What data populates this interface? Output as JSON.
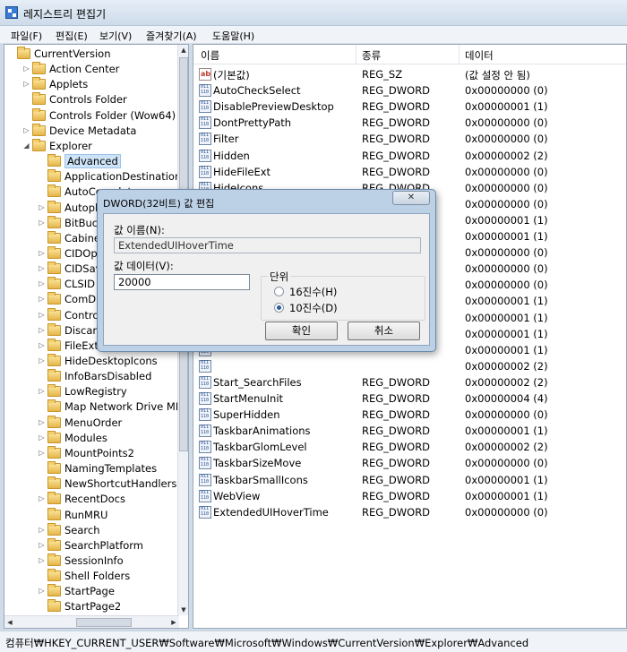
{
  "window": {
    "title": "레지스트리 편집기"
  },
  "menu": [
    "파일(F)",
    "편집(E)",
    "보기(V)",
    "즐겨찾기(A)",
    "도움말(H)"
  ],
  "tree": [
    {
      "label": "CurrentVersion",
      "level": 0,
      "expander": "",
      "selected": false
    },
    {
      "label": "Action Center",
      "level": 1,
      "expander": "▷",
      "selected": false
    },
    {
      "label": "Applets",
      "level": 1,
      "expander": "▷",
      "selected": false
    },
    {
      "label": "Controls Folder",
      "level": 1,
      "expander": "",
      "selected": false
    },
    {
      "label": "Controls Folder (Wow64)",
      "level": 1,
      "expander": "",
      "selected": false
    },
    {
      "label": "Device Metadata",
      "level": 1,
      "expander": "▷",
      "selected": false
    },
    {
      "label": "Explorer",
      "level": 1,
      "expander": "◢",
      "selected": false
    },
    {
      "label": "Advanced",
      "level": 2,
      "expander": "",
      "selected": true
    },
    {
      "label": "ApplicationDestinations",
      "level": 2,
      "expander": "",
      "selected": false
    },
    {
      "label": "AutoComplete",
      "level": 2,
      "expander": "",
      "selected": false
    },
    {
      "label": "Autoplay",
      "level": 2,
      "expander": "▷",
      "selected": false
    },
    {
      "label": "BitBucket",
      "level": 2,
      "expander": "▷",
      "selected": false
    },
    {
      "label": "CabinetState",
      "level": 2,
      "expander": "",
      "selected": false
    },
    {
      "label": "CIDOpen",
      "level": 2,
      "expander": "▷",
      "selected": false
    },
    {
      "label": "CIDSave",
      "level": 2,
      "expander": "▷",
      "selected": false
    },
    {
      "label": "CLSID",
      "level": 2,
      "expander": "▷",
      "selected": false
    },
    {
      "label": "ComDlg32",
      "level": 2,
      "expander": "▷",
      "selected": false
    },
    {
      "label": "ControlPanel",
      "level": 2,
      "expander": "▷",
      "selected": false
    },
    {
      "label": "Discardable",
      "level": 2,
      "expander": "▷",
      "selected": false
    },
    {
      "label": "FileExts",
      "level": 2,
      "expander": "▷",
      "selected": false
    },
    {
      "label": "HideDesktopIcons",
      "level": 2,
      "expander": "▷",
      "selected": false
    },
    {
      "label": "InfoBarsDisabled",
      "level": 2,
      "expander": "",
      "selected": false
    },
    {
      "label": "LowRegistry",
      "level": 2,
      "expander": "▷",
      "selected": false
    },
    {
      "label": "Map Network Drive MRU",
      "level": 2,
      "expander": "",
      "selected": false
    },
    {
      "label": "MenuOrder",
      "level": 2,
      "expander": "▷",
      "selected": false
    },
    {
      "label": "Modules",
      "level": 2,
      "expander": "▷",
      "selected": false
    },
    {
      "label": "MountPoints2",
      "level": 2,
      "expander": "▷",
      "selected": false
    },
    {
      "label": "NamingTemplates",
      "level": 2,
      "expander": "",
      "selected": false
    },
    {
      "label": "NewShortcutHandlers",
      "level": 2,
      "expander": "",
      "selected": false
    },
    {
      "label": "RecentDocs",
      "level": 2,
      "expander": "▷",
      "selected": false
    },
    {
      "label": "RunMRU",
      "level": 2,
      "expander": "",
      "selected": false
    },
    {
      "label": "Search",
      "level": 2,
      "expander": "▷",
      "selected": false
    },
    {
      "label": "SearchPlatform",
      "level": 2,
      "expander": "▷",
      "selected": false
    },
    {
      "label": "SessionInfo",
      "level": 2,
      "expander": "▷",
      "selected": false
    },
    {
      "label": "Shell Folders",
      "level": 2,
      "expander": "",
      "selected": false
    },
    {
      "label": "StartPage",
      "level": 2,
      "expander": "▷",
      "selected": false
    },
    {
      "label": "StartPage2",
      "level": 2,
      "expander": "",
      "selected": false
    }
  ],
  "list": {
    "columns": [
      "이름",
      "종류",
      "데이터"
    ],
    "rows": [
      {
        "name": "(기본값)",
        "type": "REG_SZ",
        "data": "(값 설정 안 됨)",
        "icon": "string-value-icon"
      },
      {
        "name": "AutoCheckSelect",
        "type": "REG_DWORD",
        "data": "0x00000000 (0)",
        "icon": "binary-value-icon"
      },
      {
        "name": "DisablePreviewDesktop",
        "type": "REG_DWORD",
        "data": "0x00000001 (1)",
        "icon": "binary-value-icon"
      },
      {
        "name": "DontPrettyPath",
        "type": "REG_DWORD",
        "data": "0x00000000 (0)",
        "icon": "binary-value-icon"
      },
      {
        "name": "Filter",
        "type": "REG_DWORD",
        "data": "0x00000000 (0)",
        "icon": "binary-value-icon"
      },
      {
        "name": "Hidden",
        "type": "REG_DWORD",
        "data": "0x00000002 (2)",
        "icon": "binary-value-icon"
      },
      {
        "name": "HideFileExt",
        "type": "REG_DWORD",
        "data": "0x00000000 (0)",
        "icon": "binary-value-icon"
      },
      {
        "name": "HideIcons",
        "type": "REG_DWORD",
        "data": "0x00000000 (0)",
        "icon": "binary-value-icon"
      },
      {
        "name": "",
        "type": "",
        "data": "0x00000000 (0)",
        "icon": "binary-value-icon"
      },
      {
        "name": "",
        "type": "",
        "data": "0x00000001 (1)",
        "icon": "binary-value-icon"
      },
      {
        "name": "",
        "type": "",
        "data": "0x00000001 (1)",
        "icon": "binary-value-icon"
      },
      {
        "name": "",
        "type": "",
        "data": "0x00000000 (0)",
        "icon": "binary-value-icon"
      },
      {
        "name": "",
        "type": "",
        "data": "0x00000000 (0)",
        "icon": "binary-value-icon"
      },
      {
        "name": "",
        "type": "",
        "data": "0x00000000 (0)",
        "icon": "binary-value-icon"
      },
      {
        "name": "",
        "type": "",
        "data": "0x00000001 (1)",
        "icon": "binary-value-icon"
      },
      {
        "name": "",
        "type": "",
        "data": "0x00000001 (1)",
        "icon": "binary-value-icon"
      },
      {
        "name": "",
        "type": "",
        "data": "0x00000001 (1)",
        "icon": "binary-value-icon"
      },
      {
        "name": "",
        "type": "",
        "data": "0x00000001 (1)",
        "icon": "binary-value-icon"
      },
      {
        "name": "",
        "type": "",
        "data": "0x00000002 (2)",
        "icon": "binary-value-icon"
      },
      {
        "name": "Start_SearchFiles",
        "type": "REG_DWORD",
        "data": "0x00000002 (2)",
        "icon": "binary-value-icon"
      },
      {
        "name": "StartMenuInit",
        "type": "REG_DWORD",
        "data": "0x00000004 (4)",
        "icon": "binary-value-icon"
      },
      {
        "name": "SuperHidden",
        "type": "REG_DWORD",
        "data": "0x00000000 (0)",
        "icon": "binary-value-icon"
      },
      {
        "name": "TaskbarAnimations",
        "type": "REG_DWORD",
        "data": "0x00000001 (1)",
        "icon": "binary-value-icon"
      },
      {
        "name": "TaskbarGlomLevel",
        "type": "REG_DWORD",
        "data": "0x00000002 (2)",
        "icon": "binary-value-icon"
      },
      {
        "name": "TaskbarSizeMove",
        "type": "REG_DWORD",
        "data": "0x00000000 (0)",
        "icon": "binary-value-icon"
      },
      {
        "name": "TaskbarSmallIcons",
        "type": "REG_DWORD",
        "data": "0x00000001 (1)",
        "icon": "binary-value-icon"
      },
      {
        "name": "WebView",
        "type": "REG_DWORD",
        "data": "0x00000001 (1)",
        "icon": "binary-value-icon"
      },
      {
        "name": "ExtendedUIHoverTime",
        "type": "REG_DWORD",
        "data": "0x00000000 (0)",
        "icon": "binary-value-icon"
      }
    ]
  },
  "status": {
    "path": "컴퓨터₩HKEY_CURRENT_USER₩Software₩Microsoft₩Windows₩CurrentVersion₩Explorer₩Advanced"
  },
  "dialog": {
    "title": "DWORD(32비트) 값 편집",
    "close_label": "✕",
    "name_label": "값 이름(N):",
    "name_value": "ExtendedUIHoverTime",
    "data_label": "값 데이터(V):",
    "data_value": "20000",
    "base_label": "단위",
    "radio_hex": "16진수(H)",
    "radio_dec": "10진수(D)",
    "selected_base": "dec",
    "ok_label": "확인",
    "cancel_label": "취소"
  },
  "colors": {
    "selection": "#cde3f7",
    "chrome": "#cfdbe9",
    "dialog_frame": "#bcd0e6"
  }
}
